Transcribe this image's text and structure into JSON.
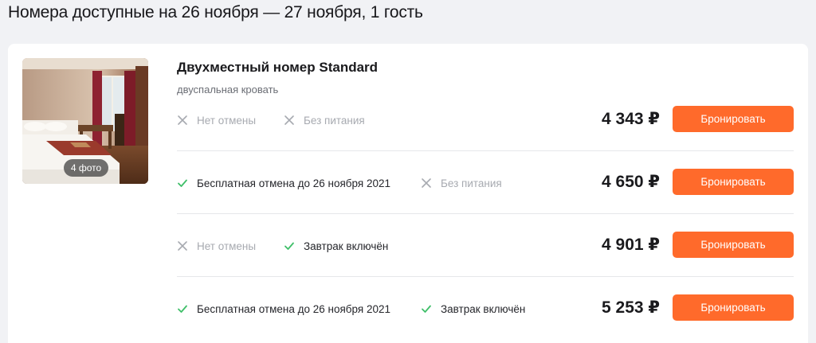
{
  "header": {
    "title": "Номера доступные на 26 ноября — 27 ноября, 1 гость"
  },
  "room": {
    "photo_count": "4 фото",
    "title": "Двухместный номер Standard",
    "bed": "двуспальная кровать",
    "rates": [
      {
        "features": [
          {
            "icon": "cross-icon",
            "positive": false,
            "label": "Нет отмены"
          },
          {
            "icon": "cross-icon",
            "positive": false,
            "label": "Без питания"
          }
        ],
        "price": "4 343 ₽",
        "button": "Бронировать"
      },
      {
        "features": [
          {
            "icon": "check-icon",
            "positive": true,
            "label": "Бесплатная отмена до 26 ноября 2021"
          },
          {
            "icon": "cross-icon",
            "positive": false,
            "label": "Без питания"
          }
        ],
        "price": "4 650 ₽",
        "button": "Бронировать"
      },
      {
        "features": [
          {
            "icon": "cross-icon",
            "positive": false,
            "label": "Нет отмены"
          },
          {
            "icon": "check-icon",
            "positive": true,
            "label": "Завтрак включён"
          }
        ],
        "price": "4 901 ₽",
        "button": "Бронировать"
      },
      {
        "features": [
          {
            "icon": "check-icon",
            "positive": true,
            "label": "Бесплатная отмена до 26 ноября 2021"
          },
          {
            "icon": "check-icon",
            "positive": true,
            "label": "Завтрак включён"
          }
        ],
        "price": "5 253 ₽",
        "button": "Бронировать"
      }
    ]
  },
  "colors": {
    "accent": "#ff6a2b",
    "check": "#3fbf69",
    "cross": "#a7aab0",
    "background": "#f1f2f5"
  }
}
